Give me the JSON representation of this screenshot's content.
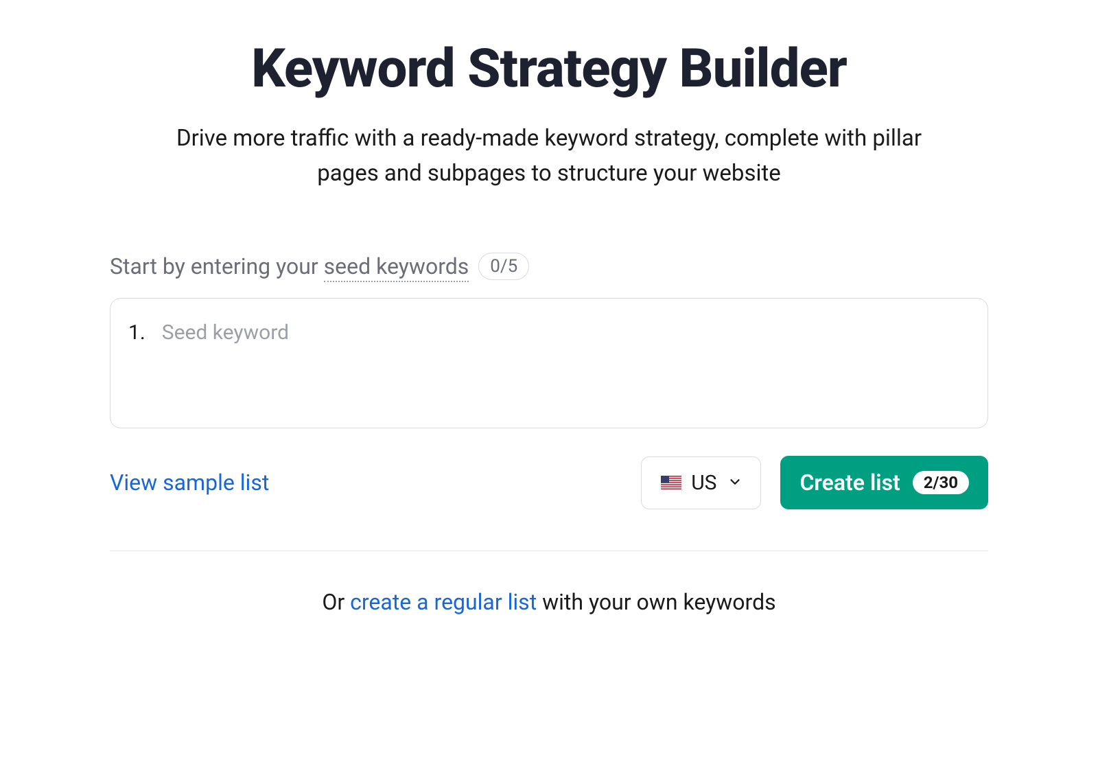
{
  "header": {
    "title": "Keyword Strategy Builder",
    "subtitle": "Drive more traffic with a ready-made keyword strategy, complete with pillar pages and subpages to structure your website"
  },
  "input_section": {
    "label_prefix": "Start by entering your ",
    "label_underlined": "seed keywords",
    "count_badge": "0/5",
    "line_number": "1.",
    "placeholder": "Seed keyword"
  },
  "actions": {
    "view_sample": "View sample list",
    "country": {
      "code": "US"
    },
    "create_button": {
      "label": "Create list",
      "count": "2/30"
    }
  },
  "footer": {
    "prefix": "Or ",
    "link": "create a regular list",
    "suffix": " with your own keywords"
  }
}
